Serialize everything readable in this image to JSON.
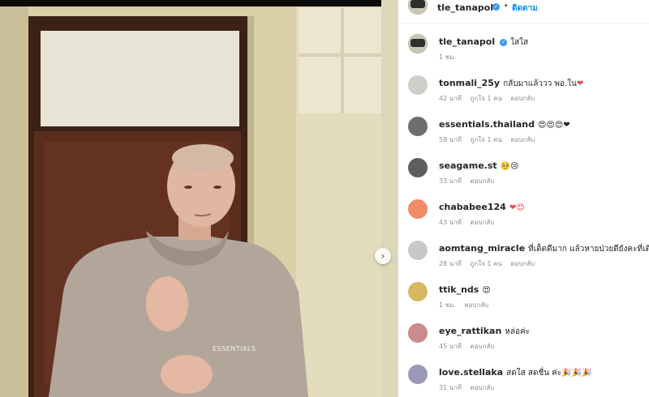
{
  "header": {
    "username": "tle_tanapol",
    "separator": "•",
    "follow_label": "ติดตาม"
  },
  "caption": {
    "username": "tle_tanapol",
    "text": "ใสใส",
    "time": "1 ชม."
  },
  "sweatshirt_text": "ESSENTIALS",
  "comments": [
    {
      "username": "tonmali_25y",
      "text": "กลับมาแล้ววว พอ.ใน",
      "emoji": "❤",
      "time": "42 นาที",
      "likes": "ถูกใจ 1 คน",
      "reply": "ตอบกลับ"
    },
    {
      "username": "essentials.thailand",
      "text": "",
      "emoji": "😍😍😍❤",
      "time": "58 นาที",
      "likes": "ถูกใจ 1 คน",
      "reply": "ตอบกลับ"
    },
    {
      "username": "seagame.st",
      "text": "",
      "emoji": "🥺😢",
      "time": "33 นาที",
      "likes": "",
      "reply": "ตอบกลับ"
    },
    {
      "username": "chababee124",
      "text": "",
      "emoji": "❤😍",
      "time": "43 นาที",
      "likes": "",
      "reply": "ตอบกลับ"
    },
    {
      "username": "aomtang_miracle",
      "text": "ที่เด็ดดีมาก แล้วหายป่วยดียังคะที่เดิ",
      "emoji": "",
      "time": "28 นาที",
      "likes": "ถูกใจ 1 คน",
      "reply": "ตอบกลับ"
    },
    {
      "username": "ttik_nds",
      "text": "",
      "emoji": "😍",
      "time": "1 ชม.",
      "likes": "",
      "reply": "ตอบกลับ"
    },
    {
      "username": "eye_rattikan",
      "text": "หล่อค่ะ",
      "emoji": "",
      "time": "45 นาที",
      "likes": "",
      "reply": "ตอบกลับ"
    },
    {
      "username": "love.stellaka",
      "text": "สดใส สดชื่น ค่ะ",
      "emoji": "🎉🎉🎉",
      "time": "31 นาที",
      "likes": "",
      "reply": "ตอบกลับ"
    }
  ]
}
